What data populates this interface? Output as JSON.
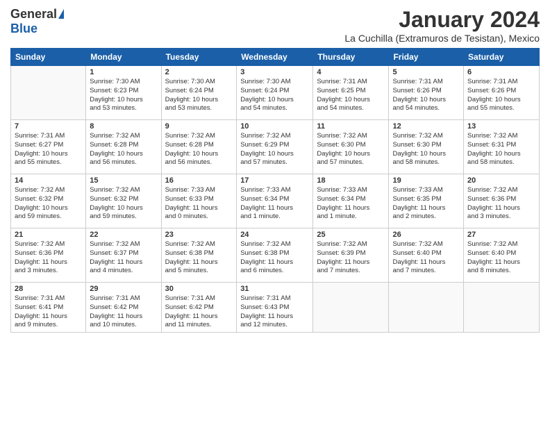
{
  "header": {
    "logo_general": "General",
    "logo_blue": "Blue",
    "title": "January 2024",
    "subtitle": "La Cuchilla (Extramuros de Tesistan), Mexico"
  },
  "calendar": {
    "days_of_week": [
      "Sunday",
      "Monday",
      "Tuesday",
      "Wednesday",
      "Thursday",
      "Friday",
      "Saturday"
    ],
    "weeks": [
      [
        {
          "day": "",
          "info": ""
        },
        {
          "day": "1",
          "info": "Sunrise: 7:30 AM\nSunset: 6:23 PM\nDaylight: 10 hours\nand 53 minutes."
        },
        {
          "day": "2",
          "info": "Sunrise: 7:30 AM\nSunset: 6:24 PM\nDaylight: 10 hours\nand 53 minutes."
        },
        {
          "day": "3",
          "info": "Sunrise: 7:30 AM\nSunset: 6:24 PM\nDaylight: 10 hours\nand 54 minutes."
        },
        {
          "day": "4",
          "info": "Sunrise: 7:31 AM\nSunset: 6:25 PM\nDaylight: 10 hours\nand 54 minutes."
        },
        {
          "day": "5",
          "info": "Sunrise: 7:31 AM\nSunset: 6:26 PM\nDaylight: 10 hours\nand 54 minutes."
        },
        {
          "day": "6",
          "info": "Sunrise: 7:31 AM\nSunset: 6:26 PM\nDaylight: 10 hours\nand 55 minutes."
        }
      ],
      [
        {
          "day": "7",
          "info": "Sunrise: 7:31 AM\nSunset: 6:27 PM\nDaylight: 10 hours\nand 55 minutes."
        },
        {
          "day": "8",
          "info": "Sunrise: 7:32 AM\nSunset: 6:28 PM\nDaylight: 10 hours\nand 56 minutes."
        },
        {
          "day": "9",
          "info": "Sunrise: 7:32 AM\nSunset: 6:28 PM\nDaylight: 10 hours\nand 56 minutes."
        },
        {
          "day": "10",
          "info": "Sunrise: 7:32 AM\nSunset: 6:29 PM\nDaylight: 10 hours\nand 57 minutes."
        },
        {
          "day": "11",
          "info": "Sunrise: 7:32 AM\nSunset: 6:30 PM\nDaylight: 10 hours\nand 57 minutes."
        },
        {
          "day": "12",
          "info": "Sunrise: 7:32 AM\nSunset: 6:30 PM\nDaylight: 10 hours\nand 58 minutes."
        },
        {
          "day": "13",
          "info": "Sunrise: 7:32 AM\nSunset: 6:31 PM\nDaylight: 10 hours\nand 58 minutes."
        }
      ],
      [
        {
          "day": "14",
          "info": "Sunrise: 7:32 AM\nSunset: 6:32 PM\nDaylight: 10 hours\nand 59 minutes."
        },
        {
          "day": "15",
          "info": "Sunrise: 7:32 AM\nSunset: 6:32 PM\nDaylight: 10 hours\nand 59 minutes."
        },
        {
          "day": "16",
          "info": "Sunrise: 7:33 AM\nSunset: 6:33 PM\nDaylight: 11 hours\nand 0 minutes."
        },
        {
          "day": "17",
          "info": "Sunrise: 7:33 AM\nSunset: 6:34 PM\nDaylight: 11 hours\nand 1 minute."
        },
        {
          "day": "18",
          "info": "Sunrise: 7:33 AM\nSunset: 6:34 PM\nDaylight: 11 hours\nand 1 minute."
        },
        {
          "day": "19",
          "info": "Sunrise: 7:33 AM\nSunset: 6:35 PM\nDaylight: 11 hours\nand 2 minutes."
        },
        {
          "day": "20",
          "info": "Sunrise: 7:32 AM\nSunset: 6:36 PM\nDaylight: 11 hours\nand 3 minutes."
        }
      ],
      [
        {
          "day": "21",
          "info": "Sunrise: 7:32 AM\nSunset: 6:36 PM\nDaylight: 11 hours\nand 3 minutes."
        },
        {
          "day": "22",
          "info": "Sunrise: 7:32 AM\nSunset: 6:37 PM\nDaylight: 11 hours\nand 4 minutes."
        },
        {
          "day": "23",
          "info": "Sunrise: 7:32 AM\nSunset: 6:38 PM\nDaylight: 11 hours\nand 5 minutes."
        },
        {
          "day": "24",
          "info": "Sunrise: 7:32 AM\nSunset: 6:38 PM\nDaylight: 11 hours\nand 6 minutes."
        },
        {
          "day": "25",
          "info": "Sunrise: 7:32 AM\nSunset: 6:39 PM\nDaylight: 11 hours\nand 7 minutes."
        },
        {
          "day": "26",
          "info": "Sunrise: 7:32 AM\nSunset: 6:40 PM\nDaylight: 11 hours\nand 7 minutes."
        },
        {
          "day": "27",
          "info": "Sunrise: 7:32 AM\nSunset: 6:40 PM\nDaylight: 11 hours\nand 8 minutes."
        }
      ],
      [
        {
          "day": "28",
          "info": "Sunrise: 7:31 AM\nSunset: 6:41 PM\nDaylight: 11 hours\nand 9 minutes."
        },
        {
          "day": "29",
          "info": "Sunrise: 7:31 AM\nSunset: 6:42 PM\nDaylight: 11 hours\nand 10 minutes."
        },
        {
          "day": "30",
          "info": "Sunrise: 7:31 AM\nSunset: 6:42 PM\nDaylight: 11 hours\nand 11 minutes."
        },
        {
          "day": "31",
          "info": "Sunrise: 7:31 AM\nSunset: 6:43 PM\nDaylight: 11 hours\nand 12 minutes."
        },
        {
          "day": "",
          "info": ""
        },
        {
          "day": "",
          "info": ""
        },
        {
          "day": "",
          "info": ""
        }
      ]
    ]
  }
}
